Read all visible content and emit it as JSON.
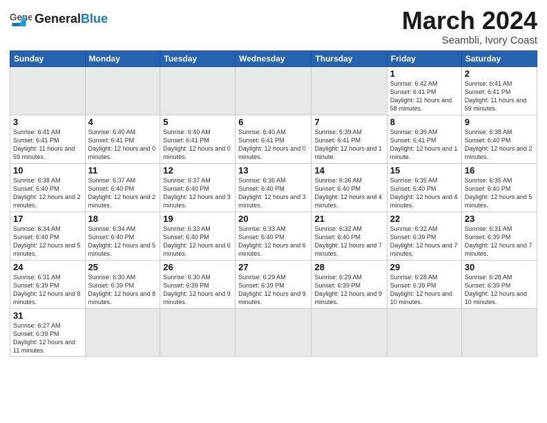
{
  "header": {
    "logo_general": "General",
    "logo_blue": "Blue",
    "month_title": "March 2024",
    "location": "Seambli, Ivory Coast"
  },
  "days_of_week": [
    "Sunday",
    "Monday",
    "Tuesday",
    "Wednesday",
    "Thursday",
    "Friday",
    "Saturday"
  ],
  "weeks": [
    [
      {
        "day": "",
        "info": "",
        "empty": true
      },
      {
        "day": "",
        "info": "",
        "empty": true
      },
      {
        "day": "",
        "info": "",
        "empty": true
      },
      {
        "day": "",
        "info": "",
        "empty": true
      },
      {
        "day": "",
        "info": "",
        "empty": true
      },
      {
        "day": "1",
        "info": "Sunrise: 6:42 AM\nSunset: 6:41 PM\nDaylight: 11 hours\nand 58 minutes."
      },
      {
        "day": "2",
        "info": "Sunrise: 6:41 AM\nSunset: 6:41 PM\nDaylight: 11 hours\nand 59 minutes."
      }
    ],
    [
      {
        "day": "3",
        "info": "Sunrise: 6:41 AM\nSunset: 6:41 PM\nDaylight: 11 hours\nand 59 minutes."
      },
      {
        "day": "4",
        "info": "Sunrise: 6:40 AM\nSunset: 6:41 PM\nDaylight: 12 hours\nand 0 minutes."
      },
      {
        "day": "5",
        "info": "Sunrise: 6:40 AM\nSunset: 6:41 PM\nDaylight: 12 hours\nand 0 minutes."
      },
      {
        "day": "6",
        "info": "Sunrise: 6:40 AM\nSunset: 6:41 PM\nDaylight: 12 hours\nand 0 minutes."
      },
      {
        "day": "7",
        "info": "Sunrise: 6:39 AM\nSunset: 6:41 PM\nDaylight: 12 hours\nand 1 minute."
      },
      {
        "day": "8",
        "info": "Sunrise: 6:39 AM\nSunset: 6:41 PM\nDaylight: 12 hours\nand 1 minute."
      },
      {
        "day": "9",
        "info": "Sunrise: 6:38 AM\nSunset: 6:40 PM\nDaylight: 12 hours\nand 2 minutes."
      }
    ],
    [
      {
        "day": "10",
        "info": "Sunrise: 6:38 AM\nSunset: 6:40 PM\nDaylight: 12 hours\nand 2 minutes."
      },
      {
        "day": "11",
        "info": "Sunrise: 6:37 AM\nSunset: 6:40 PM\nDaylight: 12 hours\nand 2 minutes."
      },
      {
        "day": "12",
        "info": "Sunrise: 6:37 AM\nSunset: 6:40 PM\nDaylight: 12 hours\nand 3 minutes."
      },
      {
        "day": "13",
        "info": "Sunrise: 6:36 AM\nSunset: 6:40 PM\nDaylight: 12 hours\nand 3 minutes."
      },
      {
        "day": "14",
        "info": "Sunrise: 6:36 AM\nSunset: 6:40 PM\nDaylight: 12 hours\nand 4 minutes."
      },
      {
        "day": "15",
        "info": "Sunrise: 6:35 AM\nSunset: 6:40 PM\nDaylight: 12 hours\nand 4 minutes."
      },
      {
        "day": "16",
        "info": "Sunrise: 6:35 AM\nSunset: 6:40 PM\nDaylight: 12 hours\nand 5 minutes."
      }
    ],
    [
      {
        "day": "17",
        "info": "Sunrise: 6:34 AM\nSunset: 6:40 PM\nDaylight: 12 hours\nand 5 minutes."
      },
      {
        "day": "18",
        "info": "Sunrise: 6:34 AM\nSunset: 6:40 PM\nDaylight: 12 hours\nand 5 minutes."
      },
      {
        "day": "19",
        "info": "Sunrise: 6:33 AM\nSunset: 6:40 PM\nDaylight: 12 hours\nand 6 minutes."
      },
      {
        "day": "20",
        "info": "Sunrise: 6:33 AM\nSunset: 6:40 PM\nDaylight: 12 hours\nand 6 minutes."
      },
      {
        "day": "21",
        "info": "Sunrise: 6:32 AM\nSunset: 6:40 PM\nDaylight: 12 hours\nand 7 minutes."
      },
      {
        "day": "22",
        "info": "Sunrise: 6:32 AM\nSunset: 6:39 PM\nDaylight: 12 hours\nand 7 minutes."
      },
      {
        "day": "23",
        "info": "Sunrise: 6:31 AM\nSunset: 6:39 PM\nDaylight: 12 hours\nand 7 minutes."
      }
    ],
    [
      {
        "day": "24",
        "info": "Sunrise: 6:31 AM\nSunset: 6:39 PM\nDaylight: 12 hours\nand 8 minutes."
      },
      {
        "day": "25",
        "info": "Sunrise: 6:30 AM\nSunset: 6:39 PM\nDaylight: 12 hours\nand 8 minutes."
      },
      {
        "day": "26",
        "info": "Sunrise: 6:30 AM\nSunset: 6:39 PM\nDaylight: 12 hours\nand 9 minutes."
      },
      {
        "day": "27",
        "info": "Sunrise: 6:29 AM\nSunset: 6:39 PM\nDaylight: 12 hours\nand 9 minutes."
      },
      {
        "day": "28",
        "info": "Sunrise: 6:29 AM\nSunset: 6:39 PM\nDaylight: 12 hours\nand 9 minutes."
      },
      {
        "day": "29",
        "info": "Sunrise: 6:28 AM\nSunset: 6:39 PM\nDaylight: 12 hours\nand 10 minutes."
      },
      {
        "day": "30",
        "info": "Sunrise: 6:28 AM\nSunset: 6:39 PM\nDaylight: 12 hours\nand 10 minutes."
      }
    ],
    [
      {
        "day": "31",
        "info": "Sunrise: 6:27 AM\nSunset: 6:39 PM\nDaylight: 12 hours\nand 11 minutes."
      },
      {
        "day": "",
        "info": "",
        "empty": true
      },
      {
        "day": "",
        "info": "",
        "empty": true
      },
      {
        "day": "",
        "info": "",
        "empty": true
      },
      {
        "day": "",
        "info": "",
        "empty": true
      },
      {
        "day": "",
        "info": "",
        "empty": true
      },
      {
        "day": "",
        "info": "",
        "empty": true
      }
    ]
  ]
}
